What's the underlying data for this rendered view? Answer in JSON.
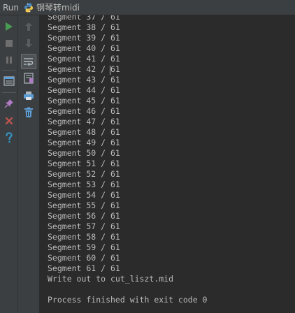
{
  "titlebar": {
    "tab_label": "Run",
    "config_name": "钢琴转midi"
  },
  "toolbar": {
    "icons": [
      "run-icon",
      "stop-icon",
      "pause-icon",
      "layout-icon",
      "pin-icon",
      "close-icon",
      "help-icon"
    ],
    "secondary_icons": [
      "up-arrow-icon",
      "down-arrow-icon",
      "soft-wrap-icon",
      "scroll-to-end-icon",
      "print-icon",
      "trash-icon"
    ]
  },
  "colors": {
    "background": "#2b2b2b",
    "toolbar": "#3c3f41",
    "text": "#bbbbbb",
    "run_green": "#499c54",
    "close_red": "#c75450",
    "help_blue": "#3592c4"
  },
  "console": {
    "lines": [
      "Segment 37 / 61",
      "Segment 38 / 61",
      "Segment 39 / 61",
      "Segment 40 / 61",
      "Segment 41 / 61",
      "Segment 42 / 61",
      "Segment 43 / 61",
      "Segment 44 / 61",
      "Segment 45 / 61",
      "Segment 46 / 61",
      "Segment 47 / 61",
      "Segment 48 / 61",
      "Segment 49 / 61",
      "Segment 50 / 61",
      "Segment 51 / 61",
      "Segment 52 / 61",
      "Segment 53 / 61",
      "Segment 54 / 61",
      "Segment 55 / 61",
      "Segment 56 / 61",
      "Segment 57 / 61",
      "Segment 58 / 61",
      "Segment 59 / 61",
      "Segment 60 / 61",
      "Segment 61 / 61",
      "Write out to cut_liszt.mid",
      "",
      "Process finished with exit code 0"
    ]
  }
}
